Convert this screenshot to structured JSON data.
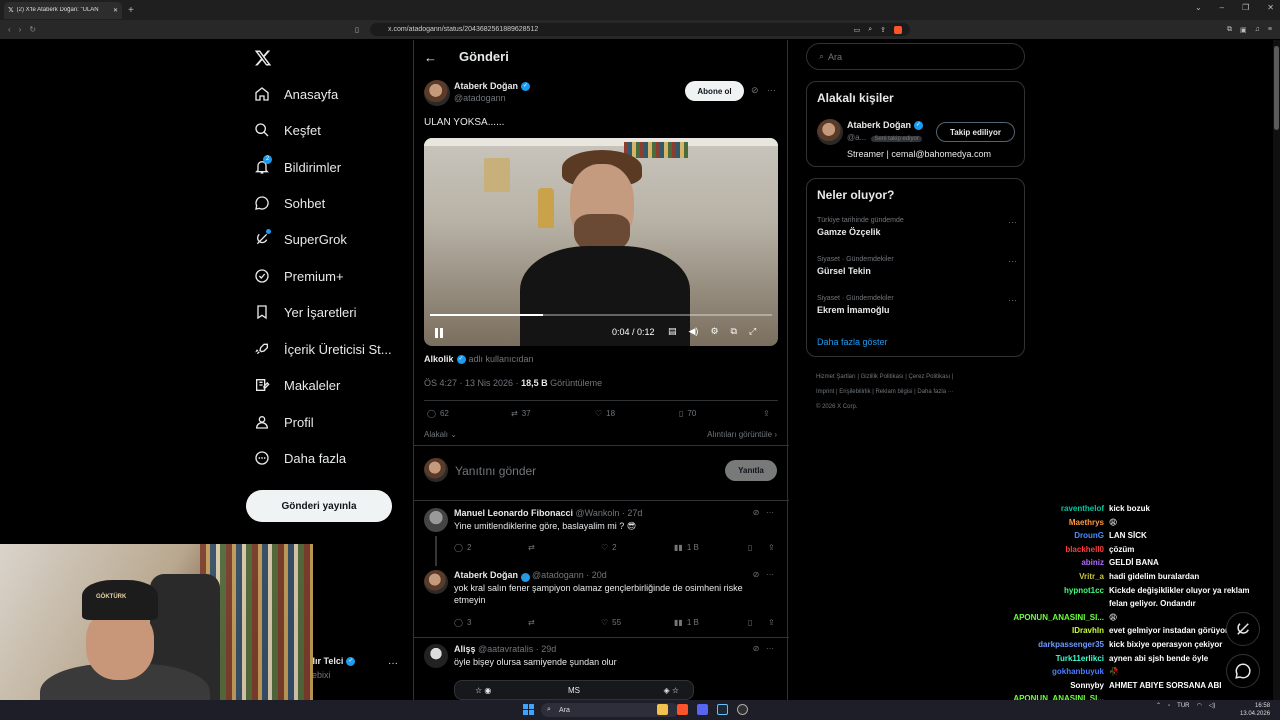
{
  "browser": {
    "tab_title": "(2) X'te Ataberk Doğan: \"ULAN",
    "url": "x.com/atadogann/status/2043682561889628512"
  },
  "nav": {
    "items": [
      {
        "label": "Anasayfa",
        "icon": "home-icon"
      },
      {
        "label": "Keşfet",
        "icon": "search-icon"
      },
      {
        "label": "Bildirimler",
        "icon": "bell-icon",
        "badge": "2"
      },
      {
        "label": "Sohbet",
        "icon": "chat-icon"
      },
      {
        "label": "SuperGrok",
        "icon": "grok-icon"
      },
      {
        "label": "Premium+",
        "icon": "premium-icon"
      },
      {
        "label": "Yer İşaretleri",
        "icon": "bookmark-icon"
      },
      {
        "label": "İçerik Üreticisi St...",
        "icon": "rocket-icon"
      },
      {
        "label": "Makaleler",
        "icon": "article-icon"
      },
      {
        "label": "Profil",
        "icon": "profile-icon"
      },
      {
        "label": "Daha fazla",
        "icon": "more-circle-icon"
      }
    ],
    "post_button": "Gönderi yayınla",
    "profile_name": "ılır Telci",
    "profile_handle": "lebixi"
  },
  "main": {
    "title": "Gönderi",
    "tweet": {
      "author_name": "Ataberk Doğan",
      "author_handle": "@atadogann",
      "follow_label": "Abone ol",
      "text": "ULAN YOKSA......",
      "video_time": "0:04 / 0:12",
      "video_progress": 0.33,
      "source_name": "Alkolik",
      "source_suffix": "adlı kullanıcıdan",
      "time": "ÖS 4:27 · 13 Nis 2026 ·",
      "views": "18,5 B",
      "views_label": "Görüntüleme",
      "replies": "62",
      "reposts": "37",
      "likes": "18",
      "bookmarks": "70",
      "related_label": "Alakalı",
      "quotes_label": "Alıntıları görüntüle"
    },
    "reply_placeholder": "Yanıtını gönder",
    "reply_button": "Yanıtla",
    "replies": [
      {
        "name": "Manuel Leonardo Fibonacci",
        "handle": "@Wankoln · 27d",
        "text": "Yine  umitlendiklerine göre, baslayalim mi ? 😎",
        "replies": "2",
        "reposts": "",
        "likes": "2",
        "views": "1 B"
      },
      {
        "name": "Ataberk Doğan",
        "handle": "@atadogann · 20d",
        "text": "yok kral salın fener şampiyon olamaz gençlerbirliğinde de osimheni riske etmeyin",
        "replies": "3",
        "reposts": "",
        "likes": "55",
        "views": "1 B"
      },
      {
        "name": "Alişş",
        "handle": "@aatavratalis · 29d",
        "text": "öyle bişey olursa samiyende şundan olur"
      }
    ],
    "match_card_label": "MS"
  },
  "right": {
    "search_placeholder": "Ara",
    "related_title": "Alakalı kişiler",
    "related_name": "Ataberk Doğan",
    "related_handle": "@a...",
    "related_follows_you": "Seni takip ediyor",
    "related_button": "Takip ediliyor",
    "related_bio": "Streamer | cemal@bahomedya.com",
    "trends_title": "Neler oluyor?",
    "trends": [
      {
        "category": "Türkiye tarihinde gündemde",
        "name": "Gamze Özçelik"
      },
      {
        "category": "Siyaset · Gündemdekiler",
        "name": "Gürsel Tekin"
      },
      {
        "category": "Siyaset · Gündemdekiler",
        "name": "Ekrem İmamoğlu"
      }
    ],
    "show_more": "Daha fazla göster",
    "footer_line1": "Hizmet Şartları  |  Gizlilik Politikası  |  Çerez Politikası  |",
    "footer_line2": "Imprint  |  Erişilebilirlik  |  Reklam bilgisi  |  Daha fazla ···",
    "footer_line3": "© 2026 X Corp."
  },
  "webcam": {
    "cap_text": "GÖKTÜRK"
  },
  "chat": [
    {
      "user": "raventhelof",
      "msg": "kick bozuk",
      "color": "#00c8a0"
    },
    {
      "user": "Maethrys",
      "msg": "😩",
      "color": "#ff9a3c"
    },
    {
      "user": "DrounG",
      "msg": "LAN SİCK",
      "color": "#4a8cff"
    },
    {
      "user": "blackhell0",
      "msg": "çözüm",
      "color": "#ff3c3c"
    },
    {
      "user": "abiniz",
      "msg": "GELDİ BANA",
      "color": "#b06cff"
    },
    {
      "user": "Vritr_a",
      "msg": "hadi gidelim buralardan",
      "color": "#c8c83c"
    },
    {
      "user": "hypnot1cc",
      "msg": "Kickde değişiklikler oluyor ya reklam",
      "color": "#3cff7a"
    },
    {
      "user": "",
      "msg": "felan geliyor. Ondandır",
      "color": "#ffffff"
    },
    {
      "user": "APONUN_ANASINI_SI...",
      "msg": "😩",
      "color": "#6cff3c"
    },
    {
      "user": "IDravhln",
      "msg": "evet gelmiyor instadan görüyorum",
      "color": "#c8ff3c"
    },
    {
      "user": "darkpassenger35",
      "msg": "kick bixiye operasyon çekiyor",
      "color": "#6c9cff"
    },
    {
      "user": "Turk11erlikci",
      "msg": "aynen abi sjsh bende öyle",
      "color": "#3cffd0"
    },
    {
      "user": "gokhanbuyuk",
      "msg": "🥀",
      "color": "#4a7cff"
    },
    {
      "user": "Sonnyby",
      "msg": "AHMET ABIYE SORSANA ABI",
      "color": "#ffffff"
    },
    {
      "user": "APONUN_ANASINI_SI...",
      "msg": "",
      "color": "#6cff3c"
    }
  ],
  "taskbar": {
    "search": "Ara",
    "lang": "TUR",
    "time": "16:58",
    "date": "13.04.2026"
  }
}
